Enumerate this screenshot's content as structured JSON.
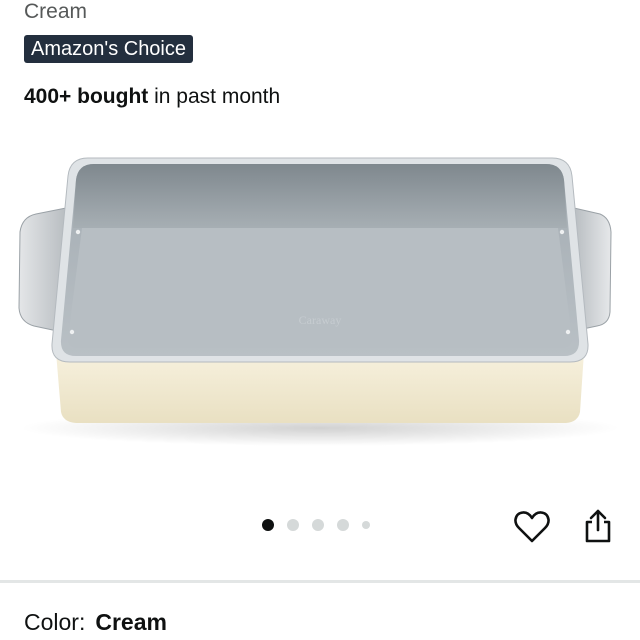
{
  "product": {
    "variant_text": "Cream",
    "badge": "Amazon's Choice",
    "bought_bold": "400+ bought",
    "bought_rest": " in past month",
    "image_brand": "Caraway"
  },
  "carousel": {
    "total_images": 5,
    "active_index": 0
  },
  "icons": {
    "wishlist": "heart-icon",
    "share": "share-icon"
  },
  "color_selector": {
    "label": "Color:",
    "value": "Cream"
  },
  "colors": {
    "badge_bg": "#232f3e",
    "pan_body": "#f3ecd6",
    "pan_interior": "#aeb6bc",
    "divider": "#e3e6e6"
  }
}
